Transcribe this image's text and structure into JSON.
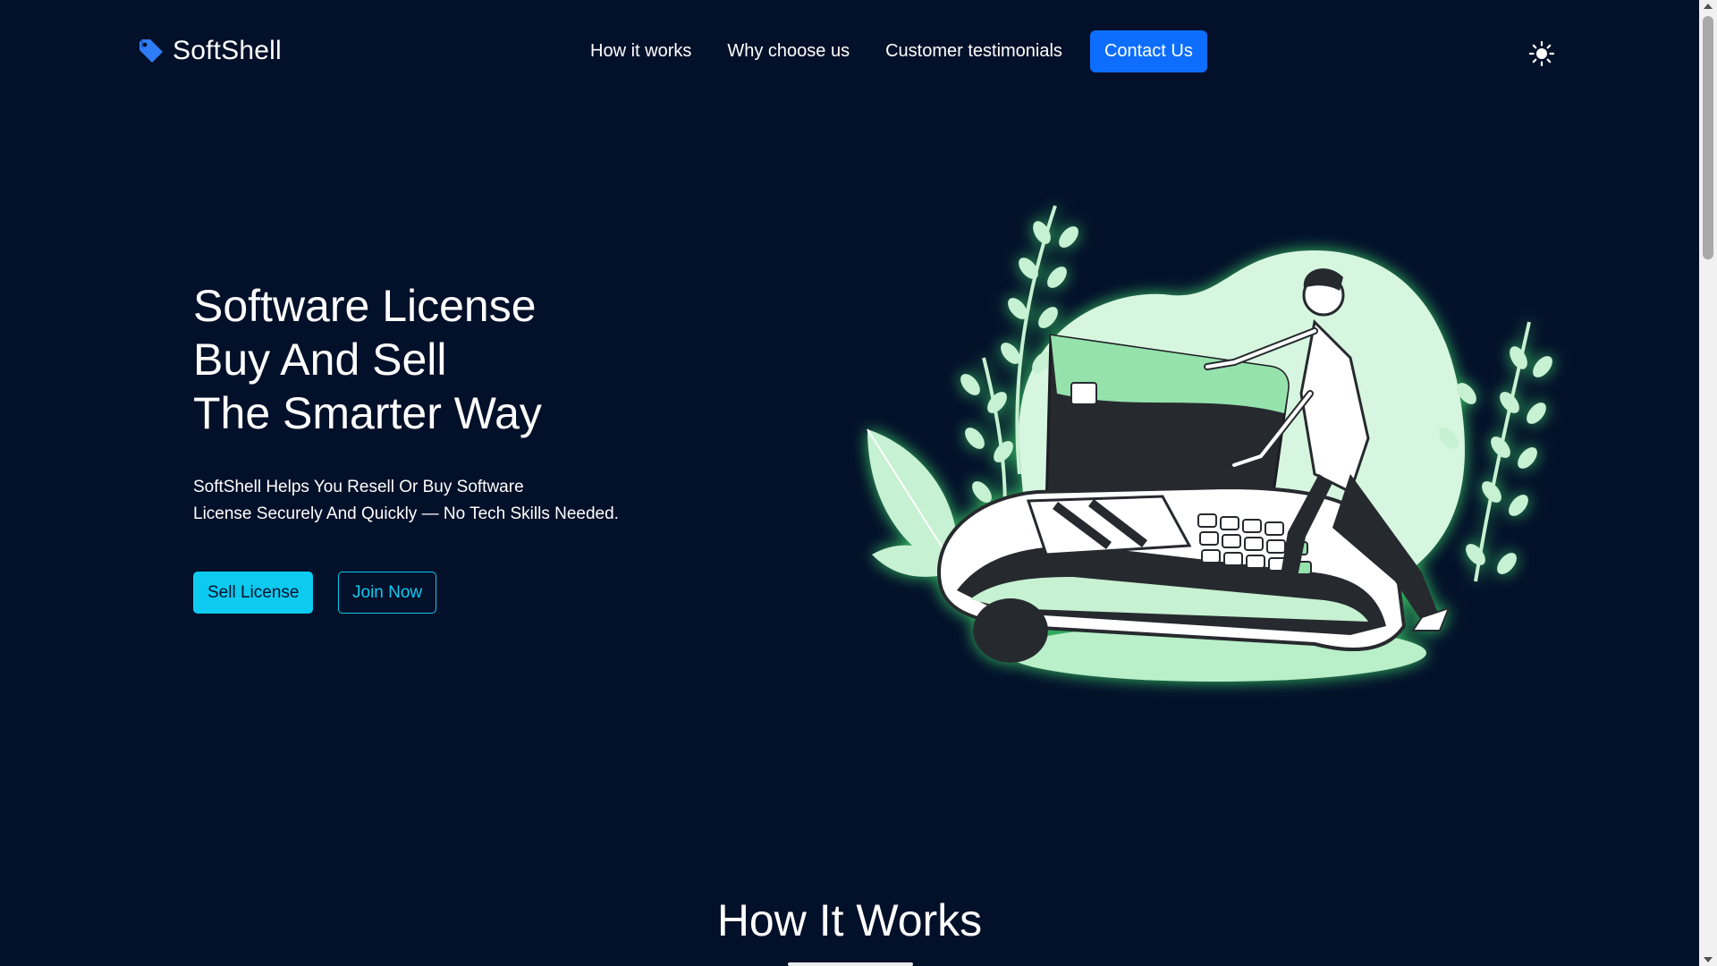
{
  "brand": {
    "name": "SoftShell",
    "icon": "tag-icon",
    "icon_color": "#2f7df6"
  },
  "nav": {
    "links": [
      "How it works",
      "Why choose us",
      "Customer testimonials"
    ],
    "cta": "Contact Us",
    "cta_color": "#0d6efd",
    "theme_icon": "sun-icon"
  },
  "hero": {
    "title_lines": [
      "Software License",
      "Buy And Sell",
      "The Smarter Way"
    ],
    "description_lines": [
      "SoftShell Helps You Resell Or Buy Software",
      "License Securely And Quickly — No Tech Skills Needed."
    ],
    "primary_button": "Sell License",
    "secondary_button": "Join Now",
    "accent_color": "#0dcaf0",
    "illustration": "person-with-card-payment-terminal-illustration"
  },
  "section": {
    "title": "How It Works"
  },
  "colors": {
    "background": "#031029",
    "illustration_green": "#b9efc9"
  }
}
